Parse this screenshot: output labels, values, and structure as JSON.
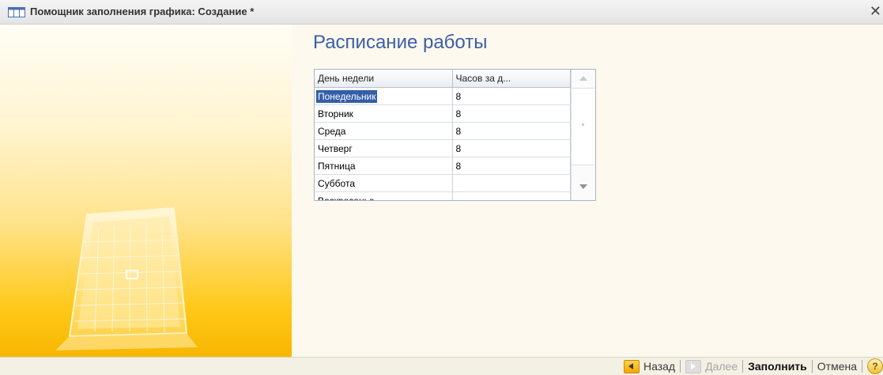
{
  "window": {
    "title": "Помощник заполнения графика: Создание *",
    "close_glyph": "✕",
    "title_icon": "table-icon"
  },
  "main": {
    "heading": "Расписание работы",
    "table": {
      "columns": [
        "День недели",
        "Часов за д..."
      ],
      "rows": [
        {
          "day": "Понедельник",
          "hours": "8"
        },
        {
          "day": "Вторник",
          "hours": "8"
        },
        {
          "day": "Среда",
          "hours": "8"
        },
        {
          "day": "Четверг",
          "hours": "8"
        },
        {
          "day": "Пятница",
          "hours": "8"
        },
        {
          "day": "Суббота",
          "hours": ""
        },
        {
          "day": "Воскресенье",
          "hours": ""
        }
      ],
      "selected_row": 0
    }
  },
  "footer": {
    "back_label": "Назад",
    "next_label": "Далее",
    "fill_label": "Заполнить",
    "cancel_label": "Отмена",
    "help_glyph": "?"
  },
  "colors": {
    "heading": "#3c5ea8",
    "selection": "#335ea8",
    "accent_yellow": "#ffc91a"
  }
}
